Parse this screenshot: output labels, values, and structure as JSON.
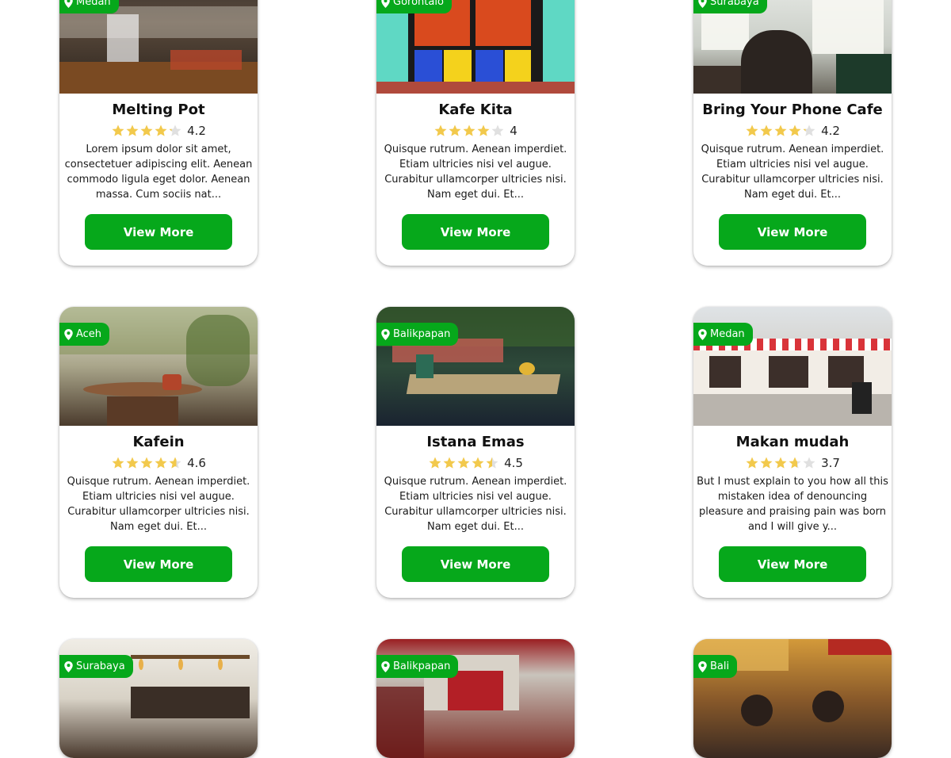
{
  "colors": {
    "accent": "#06a81b",
    "star": "#f2c94c",
    "star_empty": "#e0e0e0"
  },
  "icons": {
    "location": "map-pin-icon",
    "rating": "star-icon",
    "favorite": "heart-icon"
  },
  "cards": [
    {
      "location": "Medan",
      "name": "Melting Pot",
      "rating": "4.2",
      "rating_value": 4.2,
      "description": "Lorem ipsum dolor sit amet, consectetuer adipiscing elit. Aenean commodo ligula eget dolor. Aenean massa. Cum sociis nat...",
      "button": "View More"
    },
    {
      "location": "Gorontalo",
      "name": "Kafe Kita",
      "rating": "4",
      "rating_value": 4,
      "description": "Quisque rutrum. Aenean imperdiet. Etiam ultricies nisi vel augue. Curabitur ullamcorper ultricies nisi. Nam eget dui. Et...",
      "button": "View More"
    },
    {
      "location": "Surabaya",
      "name": "Bring Your Phone Cafe",
      "rating": "4.2",
      "rating_value": 4.2,
      "description": "Quisque rutrum. Aenean imperdiet. Etiam ultricies nisi vel augue. Curabitur ullamcorper ultricies nisi. Nam eget dui. Et...",
      "button": "View More"
    },
    {
      "location": "Aceh",
      "name": "Kafein",
      "rating": "4.6",
      "rating_value": 4.6,
      "description": "Quisque rutrum. Aenean imperdiet. Etiam ultricies nisi vel augue. Curabitur ullamcorper ultricies nisi. Nam eget dui. Et...",
      "button": "View More"
    },
    {
      "location": "Balikpapan",
      "name": "Istana Emas",
      "rating": "4.5",
      "rating_value": 4.5,
      "description": "Quisque rutrum. Aenean imperdiet. Etiam ultricies nisi vel augue. Curabitur ullamcorper ultricies nisi. Nam eget dui. Et...",
      "button": "View More"
    },
    {
      "location": "Medan",
      "name": "Makan mudah",
      "rating": "3.7",
      "rating_value": 3.7,
      "description": "But I must explain to you how all this mistaken idea of denouncing pleasure and praising pain was born and I will give y...",
      "button": "View More"
    },
    {
      "location": "Surabaya"
    },
    {
      "location": "Balikpapan"
    },
    {
      "location": "Bali"
    }
  ]
}
